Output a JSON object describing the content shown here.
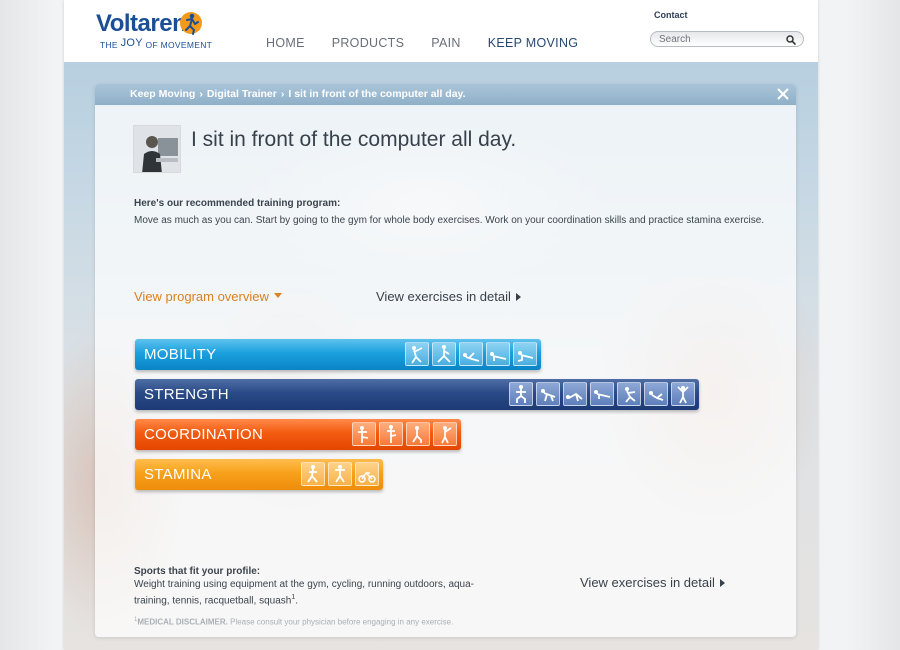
{
  "header": {
    "logo_word": "Voltaren",
    "logo_tag_the": "THE",
    "logo_tag_joy": "JOY",
    "logo_tag_rest": "OF MOVEMENT",
    "nav": [
      {
        "label": "HOME",
        "active": false
      },
      {
        "label": "PRODUCTS",
        "active": false
      },
      {
        "label": "PAIN",
        "active": false
      },
      {
        "label": "KEEP MOVING",
        "active": true
      }
    ],
    "contact": "Contact",
    "search_placeholder": "Search"
  },
  "panel": {
    "breadcrumb": [
      "Keep Moving",
      "Digital Trainer",
      "I sit in front of the computer all day."
    ],
    "breadcrumb_separator": "›",
    "title": "I sit in front of the computer all day.",
    "rec_heading": "Here's our recommended training program:",
    "rec_body": "Move as much as you can. Start by going to the gym for whole body exercises. Work on your coordination skills and practice stamina exercise.",
    "link_overview": "View program overview",
    "link_detail": "View exercises in detail",
    "bars": {
      "mobility": {
        "label": "MOBILITY",
        "icon_count": 5
      },
      "strength": {
        "label": "STRENGTH",
        "icon_count": 7
      },
      "coordination": {
        "label": "COORDINATION",
        "icon_count": 4
      },
      "stamina": {
        "label": "STAMINA",
        "icon_count": 3
      }
    },
    "sports_heading": "Sports that fit your profile:",
    "sports_body": "Weight training using equipment at the gym, cycling, running outdoors, aqua-training, tennis, racquetball, squash",
    "sports_footnote": "1",
    "link_detail_bottom": "View exercises in detail",
    "disclaimer_mark": "1",
    "disclaimer_label": "MEDICAL DISCLAIMER.",
    "disclaimer_text": "Please consult your physician before engaging in any exercise."
  },
  "colors": {
    "brand_blue": "#1a4f96",
    "logo_orange": "#f39a1d",
    "mobility": "#1ba0de",
    "strength": "#2a4a87",
    "coordination": "#f35b10",
    "stamina": "#f7a11b",
    "link_orange": "#d9821f"
  }
}
